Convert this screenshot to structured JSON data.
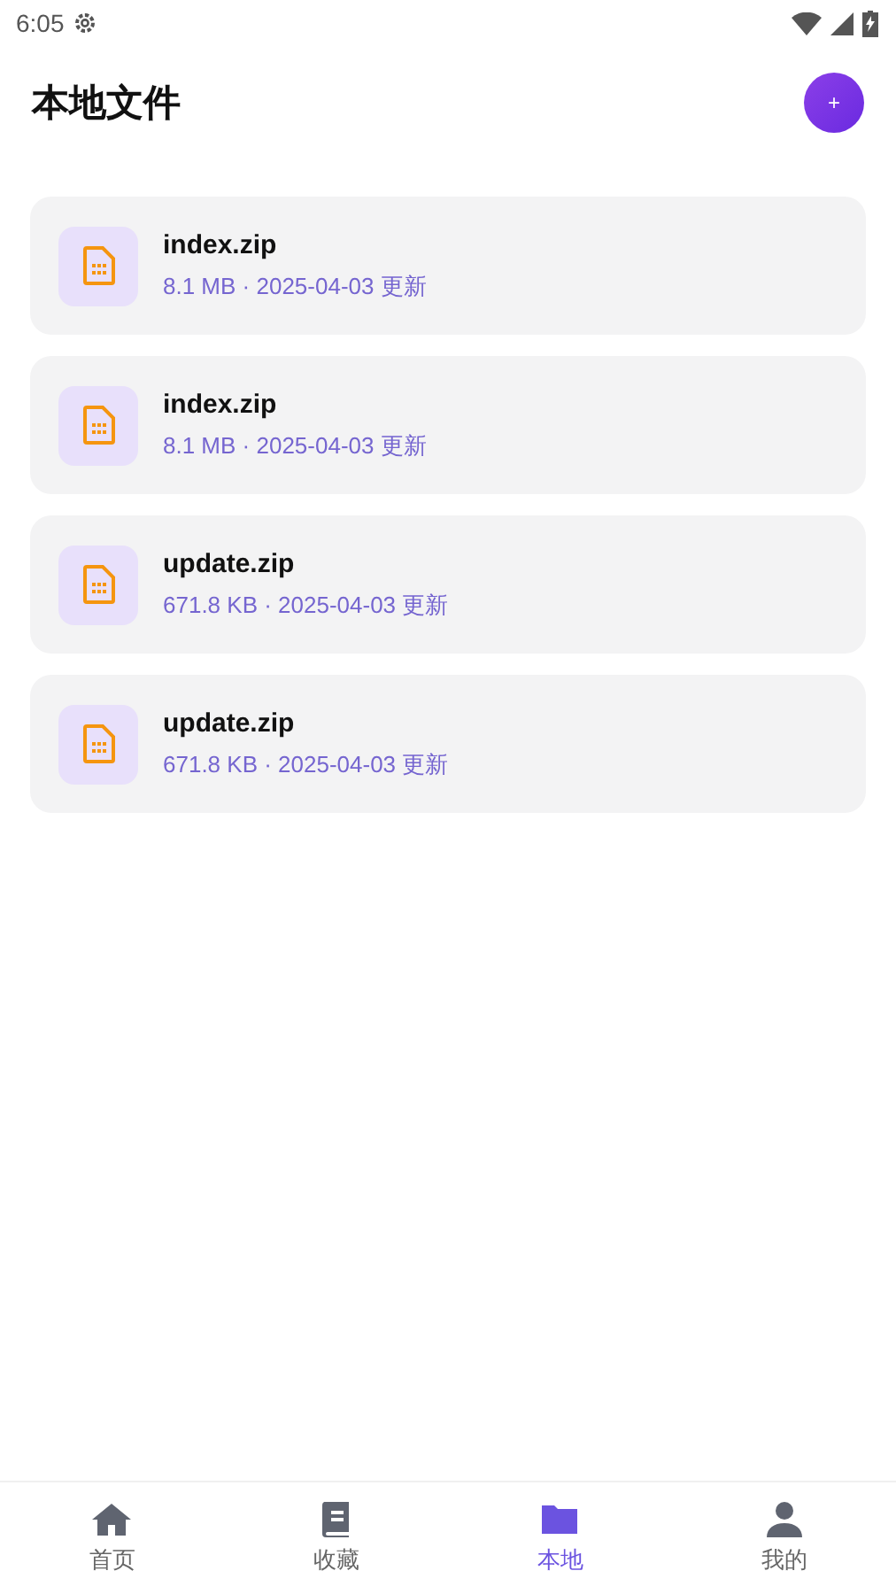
{
  "status_bar": {
    "time": "6:05"
  },
  "header": {
    "title": "本地文件",
    "add_button": "+"
  },
  "files": [
    {
      "name": "index.zip",
      "meta": "8.1 MB · 2025-04-03 更新"
    },
    {
      "name": "index.zip",
      "meta": "8.1 MB · 2025-04-03 更新"
    },
    {
      "name": "update.zip",
      "meta": "671.8 KB · 2025-04-03 更新"
    },
    {
      "name": "update.zip",
      "meta": "671.8 KB · 2025-04-03 更新"
    }
  ],
  "tabs": [
    {
      "label": "首页",
      "kind": "home",
      "selected": false
    },
    {
      "label": "收藏",
      "kind": "book",
      "selected": false
    },
    {
      "label": "本地",
      "kind": "folder",
      "selected": true
    },
    {
      "label": "我的",
      "kind": "person",
      "selected": false
    }
  ]
}
